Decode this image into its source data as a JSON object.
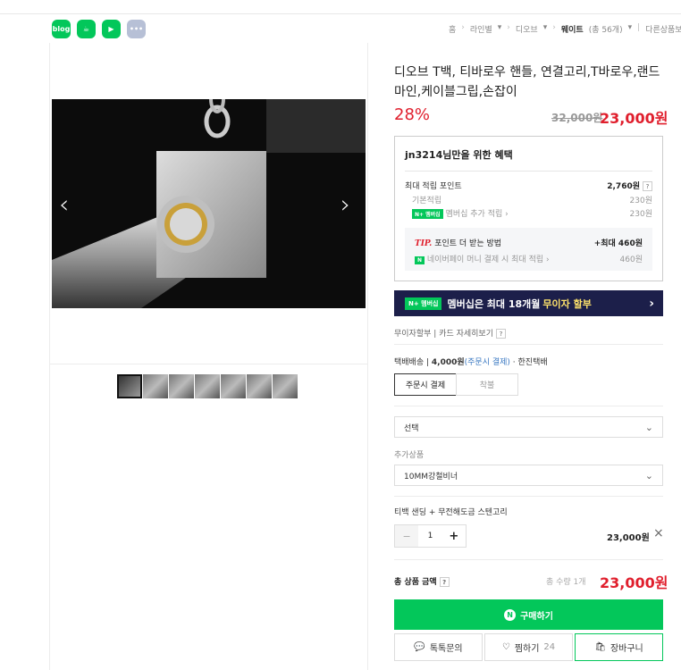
{
  "share_icons": [
    {
      "name": "blog",
      "label": "blog",
      "color": "#03c75a"
    },
    {
      "name": "cafe",
      "label": "☕",
      "color": "#03c75a"
    },
    {
      "name": "bookmark",
      "label": "▶",
      "color": "#03c75a"
    },
    {
      "name": "more",
      "label": "•••",
      "color": "#b7c0d6"
    }
  ],
  "breadcrumb": {
    "home": "홈",
    "level1": "라인별",
    "level2": "디오브",
    "level3": "웨이트",
    "count": "(총 56개)",
    "other": "다른상품보기"
  },
  "product": {
    "title": "디오브 T백, 티바로우 핸들, 연결고리,T바로우,랜드마인,케이블그립,손잡이",
    "discount": "28%",
    "original_price": "32,000원",
    "price": "23,000원"
  },
  "benefit": {
    "heading": "jn3214님만을 위한 혜택",
    "max_point_label": "최대 적립 포인트",
    "max_point_value": "2,760원",
    "basic_label": "기본적립",
    "basic_value": "230원",
    "membership_badge": "N+ 멤버십",
    "membership_label": "멤버십 추가 적립",
    "membership_value": "230원",
    "tip_label": "TIP.",
    "tip_text": "포인트 더 받는 방법",
    "tip_value": "+최대 460원",
    "npay_label": "네이버페이 머니 결제 시 최대 적립",
    "npay_value": "460원"
  },
  "banner": {
    "badge": "N+ 멤버십",
    "text": "멤버십은 최대 18개월 ",
    "highlight": "무이자 할부",
    "chevron": "›"
  },
  "installment": {
    "label": "무이자할부",
    "card": "카드 자세히보기"
  },
  "delivery": {
    "label": "택배배송",
    "fee": "4,000원",
    "fee_note": "(주문시 결제)",
    "company": "한진택배",
    "tab_pay": "주문시 결제",
    "tab_cod": "착불"
  },
  "options": {
    "select_placeholder": "선택",
    "addon_label": "추가상품",
    "addon_value": "10MM강철비너"
  },
  "selected_item": {
    "name": "티백 샌딩 + 무전해도금 스텐고리",
    "qty": "1",
    "price": "23,000원"
  },
  "total": {
    "label": "총 상품 금액",
    "qty": "총 수량 1개",
    "price": "23,000원"
  },
  "actions": {
    "buy": "구매하기",
    "talk": "톡톡문의",
    "wish": "찜하기",
    "wish_count": "24",
    "cart": "장바구니"
  }
}
